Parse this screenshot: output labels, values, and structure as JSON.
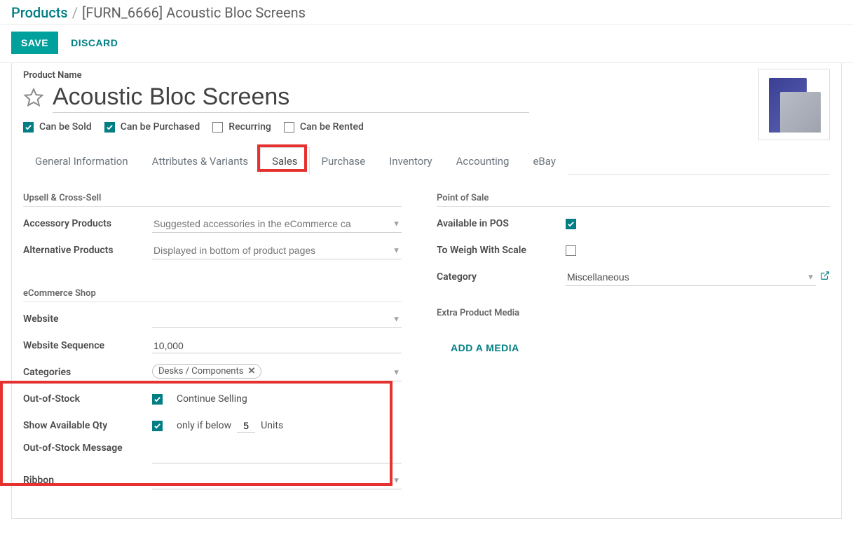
{
  "breadcrumb": {
    "root": "Products",
    "current": "[FURN_6666] Acoustic Bloc Screens"
  },
  "actions": {
    "save": "SAVE",
    "discard": "DISCARD"
  },
  "labels": {
    "product_name": "Product Name"
  },
  "product": {
    "name": "Acoustic Bloc Screens"
  },
  "checkboxes": {
    "can_sold": "Can be Sold",
    "can_purchased": "Can be Purchased",
    "recurring": "Recurring",
    "can_rented": "Can be Rented"
  },
  "tabs": {
    "general": "General Information",
    "attributes": "Attributes & Variants",
    "sales": "Sales",
    "purchase": "Purchase",
    "inventory": "Inventory",
    "accounting": "Accounting",
    "ebay": "eBay"
  },
  "left": {
    "upsell_header": "Upsell & Cross-Sell",
    "accessory_label": "Accessory Products",
    "accessory_placeholder": "Suggested accessories in the eCommerce ca",
    "alternative_label": "Alternative Products",
    "alternative_placeholder": "Displayed in bottom of product pages",
    "ecom_header": "eCommerce Shop",
    "website_label": "Website",
    "website_sequence_label": "Website Sequence",
    "website_sequence_value": "10,000",
    "categories_label": "Categories",
    "categories_tag": "Desks / Components",
    "oos_label": "Out-of-Stock",
    "continue_selling": "Continue Selling",
    "show_qty_label": "Show Available Qty",
    "only_if_below": "only if below",
    "threshold": "5",
    "units": "Units",
    "oos_msg_label": "Out-of-Stock Message",
    "ribbon_label": "Ribbon"
  },
  "right": {
    "pos_header": "Point of Sale",
    "available_pos": "Available in POS",
    "to_weigh": "To Weigh With Scale",
    "category_label": "Category",
    "category_value": "Miscellaneous",
    "extra_media_header": "Extra Product Media",
    "add_media": "ADD A MEDIA"
  }
}
